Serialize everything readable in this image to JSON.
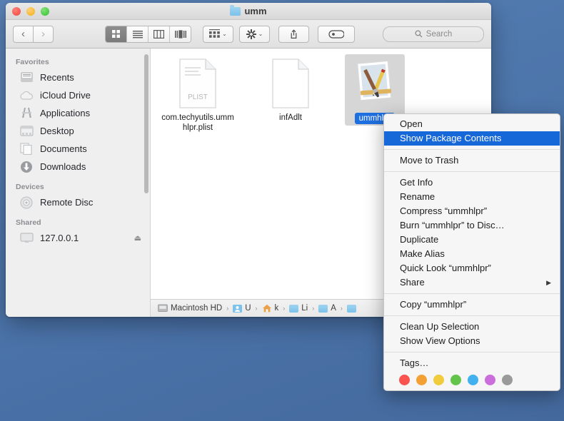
{
  "desktop": {
    "wallpaper_color": "#4f78ad"
  },
  "window": {
    "title": "umm",
    "title_icon": "folder-icon",
    "traffic_lights": [
      {
        "name": "close",
        "color": "#f6463c"
      },
      {
        "name": "minimize",
        "color": "#f4b017"
      },
      {
        "name": "zoom",
        "color": "#2ec22e"
      }
    ]
  },
  "toolbar": {
    "back_label": "‹",
    "forward_label": "›",
    "view_modes": [
      {
        "name": "icon-view",
        "active": true
      },
      {
        "name": "list-view",
        "active": false
      },
      {
        "name": "column-view",
        "active": false
      },
      {
        "name": "gallery-view",
        "active": false
      }
    ],
    "arrange_label": "",
    "action_label": "",
    "share_label": "",
    "tags_label": "",
    "caret": "⌄",
    "search": {
      "placeholder": "Search",
      "icon": "search-icon",
      "value": ""
    }
  },
  "sidebar": {
    "sections": [
      {
        "header": "Favorites",
        "items": [
          {
            "label": "Recents",
            "icon": "recents-icon"
          },
          {
            "label": "iCloud Drive",
            "icon": "cloud-icon"
          },
          {
            "label": "Applications",
            "icon": "applications-icon"
          },
          {
            "label": "Desktop",
            "icon": "desktop-icon"
          },
          {
            "label": "Documents",
            "icon": "documents-icon"
          },
          {
            "label": "Downloads",
            "icon": "downloads-icon"
          }
        ]
      },
      {
        "header": "Devices",
        "items": [
          {
            "label": "Remote Disc",
            "icon": "disc-icon"
          }
        ]
      },
      {
        "header": "Shared",
        "items": [
          {
            "label": "127.0.0.1",
            "icon": "screen-icon",
            "eject": "⏏"
          }
        ]
      }
    ]
  },
  "files": [
    {
      "name": "com.techyutils.ummhlpr.plist",
      "type": "plist",
      "badge": "PLIST",
      "selected": false
    },
    {
      "name": "infAdlt",
      "type": "blank-document",
      "badge": "",
      "selected": false
    },
    {
      "name": "ummhlpr",
      "type": "app-bundle",
      "badge": "",
      "selected": true
    }
  ],
  "pathbar": {
    "items": [
      {
        "label": "Macintosh HD",
        "icon": "harddisk-icon"
      },
      {
        "label": "U",
        "icon": "users-icon"
      },
      {
        "label": "k",
        "icon": "home-icon"
      },
      {
        "label": "Li",
        "icon": "folder-icon"
      },
      {
        "label": "A",
        "icon": "folder-icon"
      },
      {
        "label": "",
        "icon": "folder-icon"
      }
    ],
    "separator": "›"
  },
  "context_menu": {
    "groups": [
      {
        "items": [
          {
            "label": "Open",
            "highlighted": false
          },
          {
            "label": "Show Package Contents",
            "highlighted": true
          }
        ]
      },
      {
        "items": [
          {
            "label": "Move to Trash",
            "highlighted": false
          }
        ]
      },
      {
        "items": [
          {
            "label": "Get Info",
            "highlighted": false
          },
          {
            "label": "Rename",
            "highlighted": false
          },
          {
            "label": "Compress “ummhlpr”",
            "highlighted": false
          },
          {
            "label": "Burn “ummhlpr” to Disc…",
            "highlighted": false
          },
          {
            "label": "Duplicate",
            "highlighted": false
          },
          {
            "label": "Make Alias",
            "highlighted": false
          },
          {
            "label": "Quick Look “ummhlpr”",
            "highlighted": false
          },
          {
            "label": "Share",
            "highlighted": false,
            "submenu": "▶"
          }
        ]
      },
      {
        "items": [
          {
            "label": "Copy “ummhlpr”",
            "highlighted": false
          }
        ]
      },
      {
        "items": [
          {
            "label": "Clean Up Selection",
            "highlighted": false
          },
          {
            "label": "Show View Options",
            "highlighted": false
          }
        ]
      },
      {
        "items": [
          {
            "label": "Tags…",
            "highlighted": false
          }
        ]
      }
    ],
    "highlight_color": "#1667d8",
    "tag_colors": [
      {
        "name": "red",
        "hex": "#f9544f"
      },
      {
        "name": "orange",
        "hex": "#f3a135"
      },
      {
        "name": "yellow",
        "hex": "#f0cb3c"
      },
      {
        "name": "green",
        "hex": "#62c44a"
      },
      {
        "name": "blue",
        "hex": "#43b0ef"
      },
      {
        "name": "purple",
        "hex": "#cc6ddc"
      },
      {
        "name": "gray",
        "hex": "#9a9a9a"
      }
    ]
  }
}
